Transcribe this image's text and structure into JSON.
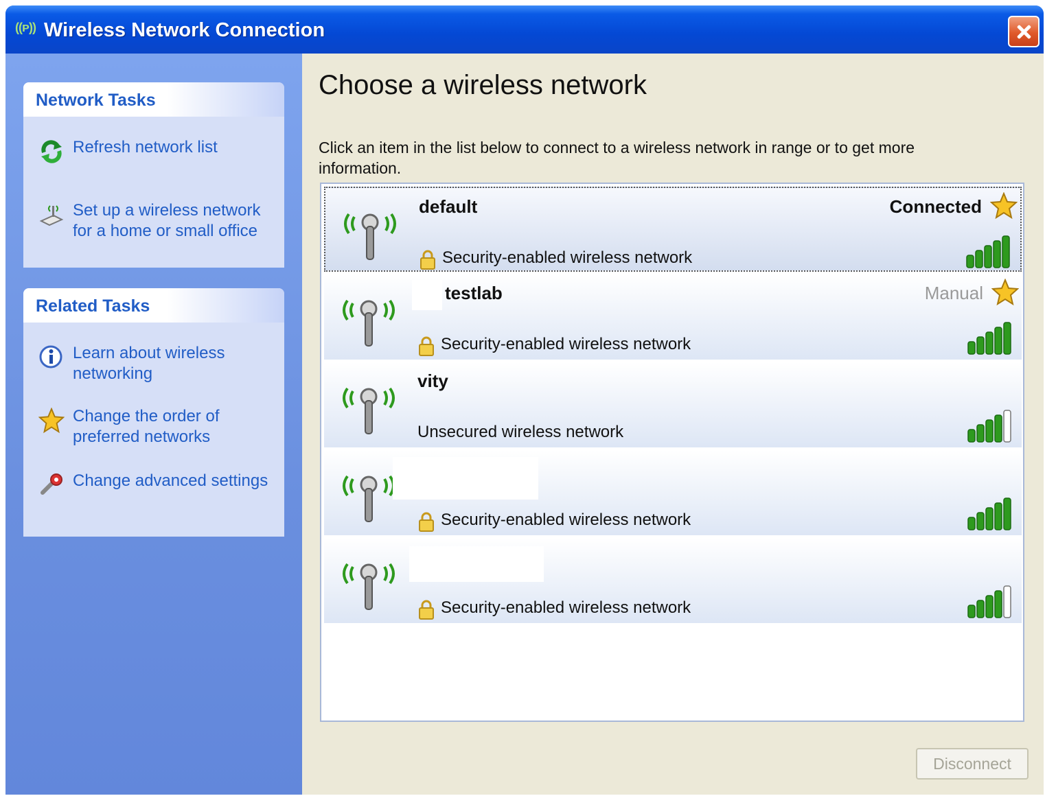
{
  "window": {
    "title": "Wireless Network Connection",
    "title_icon_glyph": "((ᴘ))"
  },
  "sidebar": {
    "network_tasks": {
      "title": "Network Tasks",
      "items": [
        {
          "label": "Refresh network list",
          "icon": "refresh-icon"
        },
        {
          "label": "Set up a wireless network for a home or small office",
          "icon": "wireless-setup-icon"
        }
      ]
    },
    "related_tasks": {
      "title": "Related Tasks",
      "items": [
        {
          "label": "Learn about wireless networking",
          "icon": "info-icon"
        },
        {
          "label": "Change the order of preferred networks",
          "icon": "star-icon"
        },
        {
          "label": "Change advanced settings",
          "icon": "settings-icon"
        }
      ]
    }
  },
  "main": {
    "heading": "Choose a wireless network",
    "instructions": "Click an item in the list below to connect to a wireless network in range or to get more information.",
    "networks": [
      {
        "name": "default",
        "status": "Connected",
        "security": "Security-enabled wireless network",
        "secured": true,
        "preferred": true,
        "signal_bars": 5,
        "selected": true
      },
      {
        "name": "testlab",
        "status": "Manual",
        "security": "Security-enabled wireless network",
        "secured": true,
        "preferred": true,
        "signal_bars": 5,
        "selected": false
      },
      {
        "name": "vity",
        "status": "",
        "security": "Unsecured wireless network",
        "secured": false,
        "preferred": false,
        "signal_bars": 4,
        "selected": false
      },
      {
        "name": "",
        "status": "",
        "security": "Security-enabled wireless network",
        "secured": true,
        "preferred": false,
        "signal_bars": 5,
        "selected": false
      },
      {
        "name": "",
        "status": "",
        "security": "Security-enabled wireless network",
        "secured": true,
        "preferred": false,
        "signal_bars": 4,
        "selected": false
      }
    ],
    "disconnect_label": "Disconnect"
  },
  "colors": {
    "titlebar": "#0448d4",
    "sidebar": "#6a8fdf",
    "task_link": "#215dc6",
    "signal": "#2e9a1e",
    "antenna_waves": "#2e9a1e"
  }
}
